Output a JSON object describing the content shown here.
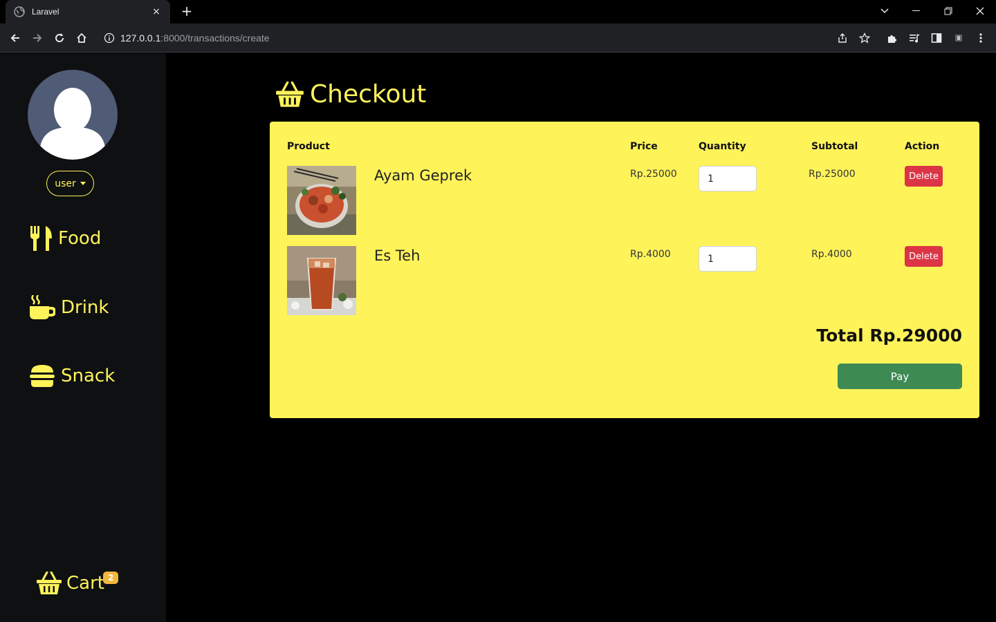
{
  "browser": {
    "tab_title": "Laravel",
    "tab_close": "×",
    "new_tab": "+",
    "url_host": "127.0.0.1",
    "url_path": ":8000/transactions/create"
  },
  "sidebar": {
    "user_label": "user",
    "nav": [
      {
        "label": "Food",
        "icon": "utensils-icon"
      },
      {
        "label": "Drink",
        "icon": "coffee-cup-icon"
      },
      {
        "label": "Snack",
        "icon": "burger-icon"
      }
    ],
    "cart_label": "Cart",
    "cart_count": "2"
  },
  "main": {
    "title": "Checkout",
    "table": {
      "headers": {
        "product": "Product",
        "price": "Price",
        "quantity": "Quantity",
        "subtotal": "Subtotal",
        "action": "Action"
      },
      "rows": [
        {
          "name": "Ayam Geprek",
          "price": "Rp.25000",
          "quantity": "1",
          "subtotal": "Rp.25000",
          "action": "Delete"
        },
        {
          "name": "Es Teh",
          "price": "Rp.4000",
          "quantity": "1",
          "subtotal": "Rp.4000",
          "action": "Delete"
        }
      ]
    },
    "total": "Total Rp.29000",
    "pay_label": "Pay"
  },
  "colors": {
    "accent": "#fff35a",
    "sidebar_bg": "#0f1012",
    "delete": "#dc3545",
    "pay": "#3d8a53",
    "badge": "#f2b83c"
  }
}
